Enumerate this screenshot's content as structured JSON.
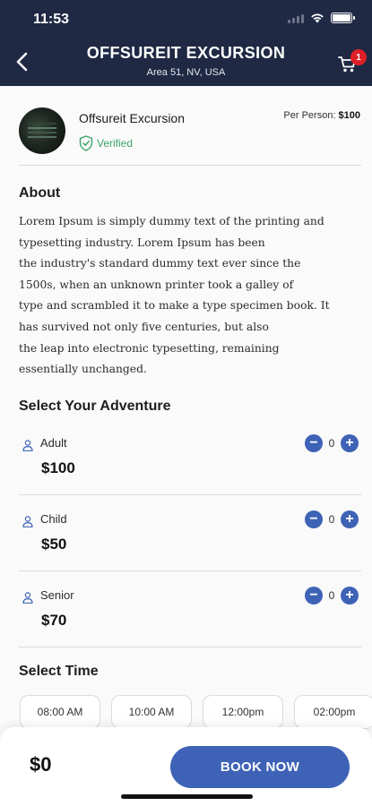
{
  "status_bar": {
    "time": "11:53"
  },
  "header": {
    "title": "OFFSUREIT EXCURSION",
    "subtitle": "Area 51, NV, USA",
    "cart_count": "1",
    "background": "#1f2944"
  },
  "listing": {
    "name": "Offsureit Excursion",
    "verified_label": "Verified",
    "per_person_label": "Per Person:",
    "per_person_price": "$100"
  },
  "about": {
    "title": "About",
    "lines": [
      "Lorem Ipsum is simply dummy text of the printing and",
      "typesetting industry. Lorem Ipsum has been",
      "the industry's standard dummy text ever since the",
      "1500s, when an unknown printer took a galley of",
      "type and scrambled it to make a type specimen book. It",
      "has survived not only five centuries, but also",
      "the leap into electronic typesetting, remaining",
      "essentially unchanged."
    ]
  },
  "adventure": {
    "title": "Select Your Adventure",
    "options": [
      {
        "label": "Adult",
        "price": "$100",
        "count": "0"
      },
      {
        "label": "Child",
        "price": "$50",
        "count": "0"
      },
      {
        "label": "Senior",
        "price": "$70",
        "count": "0"
      }
    ]
  },
  "time": {
    "title": "Select Time",
    "slots": [
      "08:00 AM",
      "10:00 AM",
      "12:00pm",
      "02:00pm"
    ]
  },
  "footer": {
    "total": "$0",
    "book_label": "BOOK NOW",
    "accent": "#3e63b6"
  }
}
